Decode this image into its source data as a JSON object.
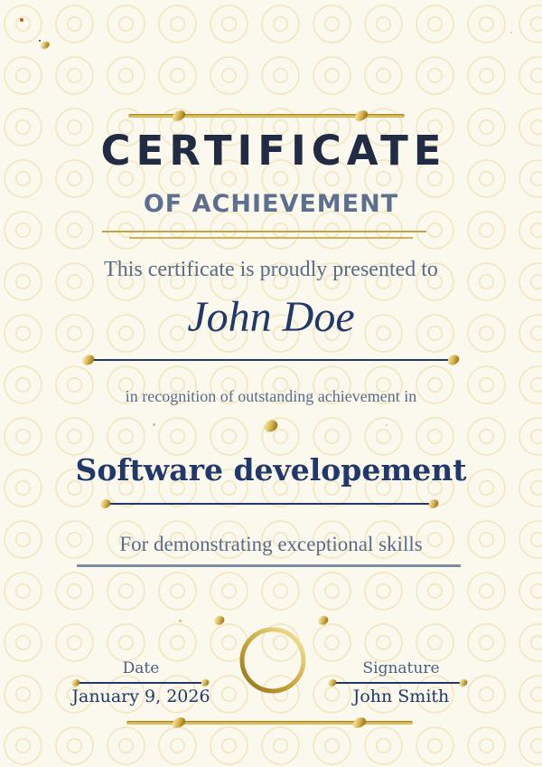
{
  "certificate": {
    "title": "CERTIFICATE",
    "subtitle": "OF ACHIEVEMENT",
    "presented_line": "This certificate is proudly presented to",
    "recipient_name": "John Doe",
    "recognition_line": "in recognition of outstanding achievement in",
    "achievement_field": "Software developement",
    "skills_line": "For demonstrating exceptional skills",
    "date": {
      "label": "Date",
      "value": "January 9, 2026"
    },
    "signature": {
      "label": "Signature",
      "value": "John Smith"
    }
  },
  "colors": {
    "background": "#fbf9ee",
    "pattern_ring": "#f3e7c3",
    "title_navy": "#212c44",
    "heading_blue_gray": "#5d6f8e",
    "body_blue_gray": "#5a6b88",
    "navy_text": "#20386b",
    "gold": "#c9a43a",
    "muted_line": "#7e8ca2"
  }
}
